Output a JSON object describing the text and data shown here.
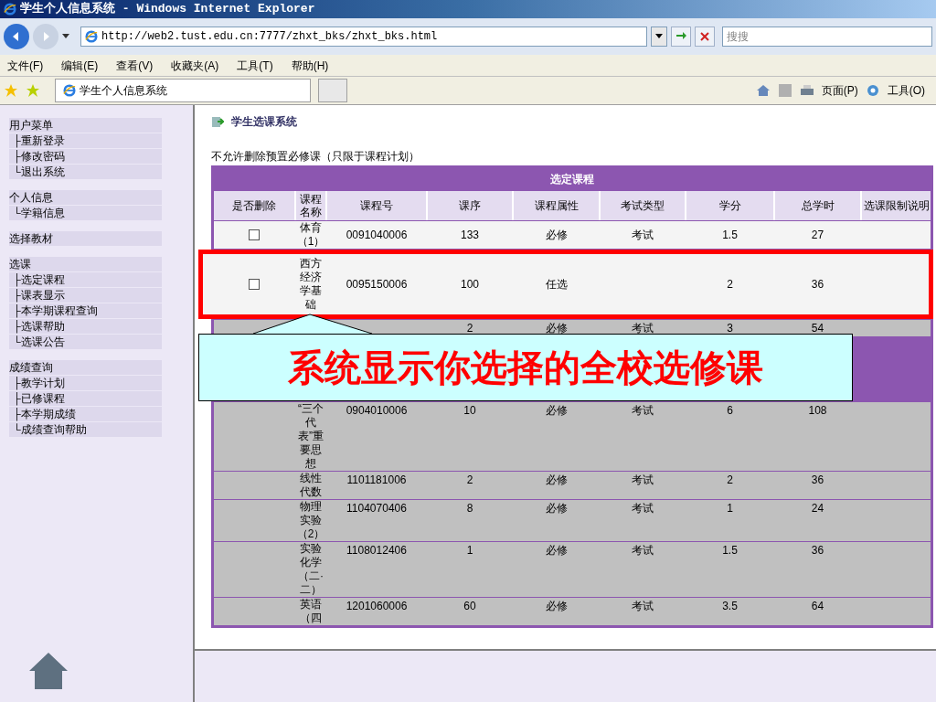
{
  "window": {
    "title": "学生个人信息系统 - Windows Internet Explorer"
  },
  "address_bar": {
    "url": "http://web2.tust.edu.cn:7777/zhxt_bks/zhxt_bks.html",
    "search_placeholder": "搜搜"
  },
  "menu_bar": [
    "文件(F)",
    "编辑(E)",
    "查看(V)",
    "收藏夹(A)",
    "工具(T)",
    "帮助(H)"
  ],
  "favorites_bar": {
    "tab": "学生个人信息系统",
    "page_menu": "页面(P)",
    "tools_menu": "工具(O)"
  },
  "sidebar": {
    "groups": [
      {
        "title": "用户菜单",
        "children": [
          "├重新登录",
          "├修改密码",
          "└退出系统"
        ]
      },
      {
        "title": "个人信息",
        "children": [
          "└学籍信息"
        ]
      },
      {
        "title": "选择教材"
      },
      {
        "title": "选课",
        "children": [
          "├选定课程",
          "├课表显示",
          "├本学期课程查询",
          "├选课帮助",
          "└选课公告"
        ]
      },
      {
        "title": "成绩查询",
        "children": [
          "├教学计划",
          "├已修课程",
          "├本学期成绩",
          "└成绩查询帮助"
        ]
      }
    ]
  },
  "page": {
    "title": "学生选课系统",
    "notice": "不允许删除预置必修课（只限于课程计划）"
  },
  "table": {
    "caption": "选定课程",
    "columns": [
      "是否删除",
      "课程名称",
      "课程号",
      "课序",
      "课程属性",
      "考试类型",
      "学分",
      "总学时",
      "选课限制说明"
    ],
    "rows": [
      {
        "deletable": true,
        "checked": false,
        "highlighted": false,
        "cells": [
          "",
          "体育（1）",
          "0091040006",
          "133",
          "必修",
          "考试",
          "1.5",
          "27",
          ""
        ]
      },
      {
        "deletable": true,
        "checked": false,
        "highlighted": true,
        "cells": [
          "",
          "西方经济学基础",
          "0095150006",
          "100",
          "任选",
          "",
          "2",
          "36",
          ""
        ]
      },
      {
        "deletable": false,
        "highlighted": false,
        "cells": [
          "",
          "",
          "",
          "2",
          "必修",
          "考试",
          "3",
          "54",
          ""
        ]
      },
      {
        "deletable": false,
        "highlighted": false,
        "cells": [
          "",
          "“三个代表”重要思想",
          "0904010006",
          "10",
          "必修",
          "考试",
          "6",
          "108",
          ""
        ]
      },
      {
        "deletable": false,
        "highlighted": false,
        "cells": [
          "",
          "线性代数",
          "1101181006",
          "2",
          "必修",
          "考试",
          "2",
          "36",
          ""
        ]
      },
      {
        "deletable": false,
        "highlighted": false,
        "cells": [
          "",
          "物理实验（2）",
          "1104070406",
          "8",
          "必修",
          "考试",
          "1",
          "24",
          ""
        ]
      },
      {
        "deletable": false,
        "highlighted": false,
        "cells": [
          "",
          "实验化学（二·二）",
          "1108012406",
          "1",
          "必修",
          "考试",
          "1.5",
          "36",
          ""
        ]
      },
      {
        "deletable": false,
        "highlighted": false,
        "cells": [
          "",
          "英语（四",
          "1201060006",
          "60",
          "必修",
          "考试",
          "3.5",
          "64",
          ""
        ]
      }
    ]
  },
  "callout": {
    "text": "系统显示你选择的全校选修课"
  }
}
